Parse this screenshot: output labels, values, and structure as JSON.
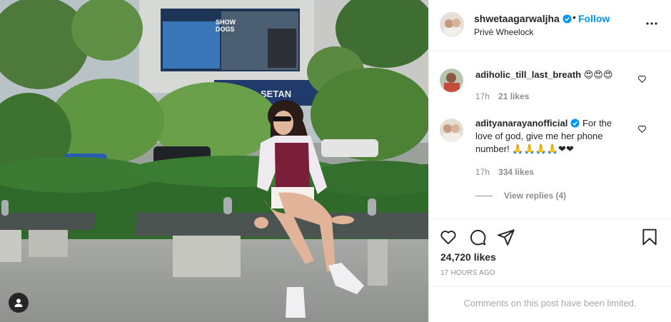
{
  "post": {
    "author": "shwetaagarwaljha",
    "follow_separator": "•",
    "follow_label": "Follow",
    "location": "Privé Wheelock",
    "author_verified": true
  },
  "billboard": {
    "movie_title_line1": "SHOW",
    "movie_title_line2": "DOGS",
    "store_sign": "SETAN"
  },
  "comments": [
    {
      "username": "adiholic_till_last_breath",
      "text": "😍😍😍",
      "age": "17h",
      "likes": "21 likes",
      "verified": false
    },
    {
      "username": "adityanarayanofficial",
      "text": "For the love of god, give me her phone number! 🙏🙏🙏🙏❤❤",
      "age": "17h",
      "likes": "334 likes",
      "verified": true,
      "view_replies": "View replies (4)"
    }
  ],
  "engagement": {
    "likes_count": "24,720 likes",
    "timestamp": "17 HOURS AGO"
  },
  "comments_limited": "Comments on this post have been limited.",
  "colors": {
    "link_blue": "#0095f6",
    "text": "#262626",
    "muted": "#8e8e8e",
    "border": "#efefef"
  },
  "icons": [
    "user-tag-icon",
    "verified-badge-icon",
    "more-options-icon",
    "heart-icon",
    "comment-icon",
    "share-icon",
    "bookmark-icon"
  ]
}
